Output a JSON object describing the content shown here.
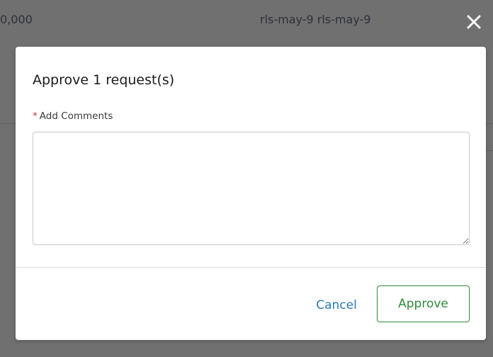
{
  "background": {
    "left_text": "0,000",
    "center_text": "rls-may-9 rls-may-9",
    "close_icon": "close-icon"
  },
  "modal": {
    "title": "Approve 1 request(s)",
    "required_marker": "*",
    "comments_label": "Add Comments",
    "comments_value": "",
    "cancel_label": "Cancel",
    "approve_label": "Approve"
  },
  "colors": {
    "overlay": "#707070",
    "accent_link": "#2a7ab8",
    "approve_green": "#2e8c3a",
    "required_red": "#c23934"
  }
}
